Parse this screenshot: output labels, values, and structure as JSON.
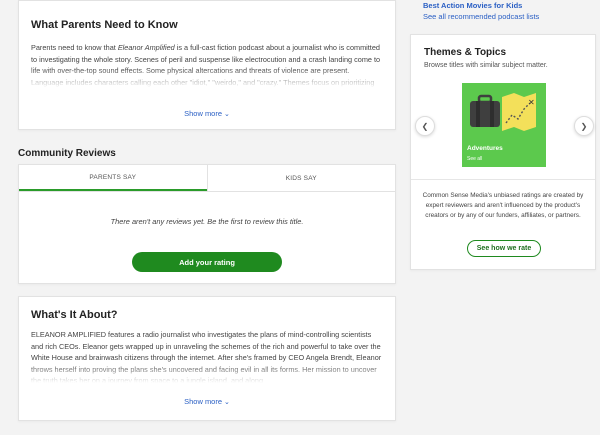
{
  "parents": {
    "title": "What Parents Need to Know",
    "body_pre": "Parents need to know that ",
    "body_italic": "Eleanor Amplified",
    "body_post": " is a full-cast fiction podcast about a journalist who is committed to investigating the whole story. Scenes of peril and suspense like electrocution and a crash landing come to life with over-the-top sound effects. Some physical altercations and threats of violence are present. Language includes characters calling each other \"idiot,\" \"weirdo,\" and \"crazy.\" Themes focus on prioritizing integrity and humility over personal gain and reputation as well as understanding power",
    "show_more": "Show more"
  },
  "community": {
    "title": "Community Reviews",
    "tabs": [
      {
        "label": "PARENTS SAY"
      },
      {
        "label": "KIDS SAY"
      }
    ],
    "empty_text": "There aren't any reviews yet. Be the first to review this title.",
    "add_rating": "Add your rating"
  },
  "about": {
    "title": "What's It About?",
    "body": "ELEANOR AMPLIFIED features a radio journalist who investigates the plans of mind-controlling scientists and rich CEOs. Eleanor gets wrapped up in unraveling the schemes of the rich and powerful to take over the White House and brainwash citizens through the internet. After she's framed by CEO Angela Brendt, Eleanor throws herself into proving the plans she's uncovered and facing evil in all its forms. Her mission to uncover the truth takes her on a journey from space to a jungle island, and along",
    "show_more": "Show more"
  },
  "right": {
    "links": [
      {
        "label": "Best Action Movies for Kids"
      },
      {
        "label": "See all recommended podcast lists"
      }
    ],
    "themes": {
      "title": "Themes & Topics",
      "subtitle": "Browse titles with similar subject matter.",
      "tile_name": "Adventures",
      "tile_see": "See all",
      "tile_color": "#5cc94d"
    },
    "disclaimer": "Common Sense Media's unbiased ratings are created by expert reviewers and aren't influenced by the product's creators or by any of our funders, affiliates, or partners.",
    "how_rate": "See how we rate"
  },
  "colors": {
    "accent_green": "#1f8a1f",
    "link_blue": "#2a5fc4"
  }
}
